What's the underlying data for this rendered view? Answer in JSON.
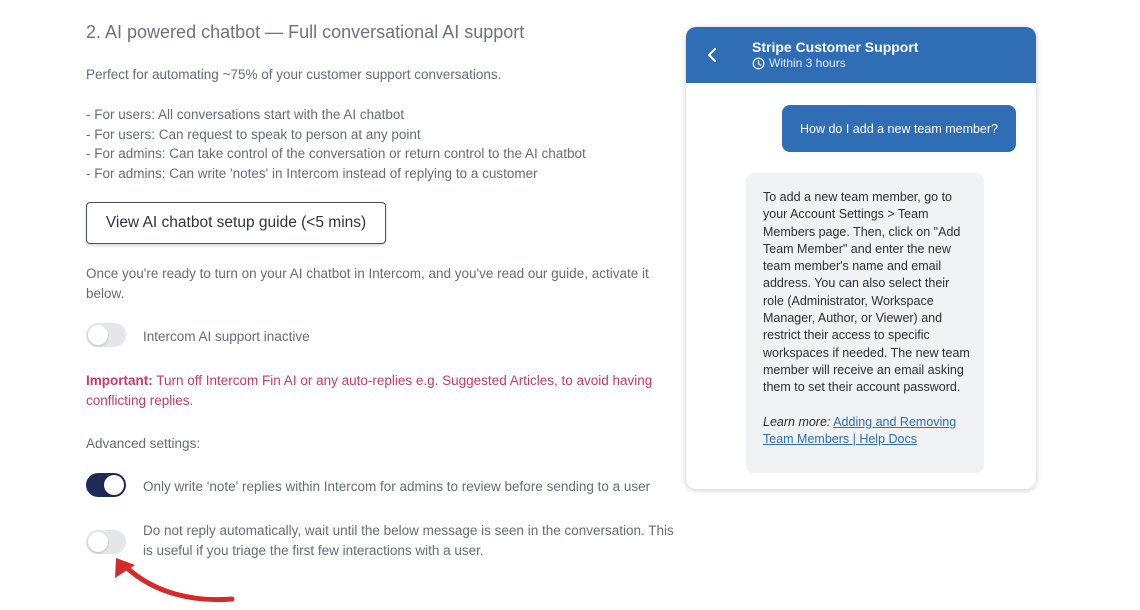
{
  "section": {
    "title": "2. AI powered chatbot — Full conversational AI support",
    "intro": "Perfect for automating ~75% of your customer support conversations.",
    "bullets": [
      "- For users: All conversations start with the AI chatbot",
      "- For users: Can request to speak to person at any point",
      "- For admins: Can take control of the conversation or return control to the AI chatbot",
      "- For admins: Can write 'notes' in Intercom instead of replying to a customer"
    ],
    "guide_button": "View AI chatbot setup guide (<5 mins)",
    "activate_text": "Once you're ready to turn on your AI chatbot in Intercom, and you've read our guide, activate it below.",
    "ai_toggle": {
      "label": "Intercom AI support inactive",
      "on": false
    },
    "important": {
      "prefix": "Important:",
      "text": " Turn off Intercom Fin AI or any auto-replies e.g. Suggested Articles, to avoid having conflicting replies."
    },
    "advanced_heading": "Advanced settings:",
    "note_toggle": {
      "label": "Only write 'note' replies within Intercom for admins to review before sending to a user",
      "on": true
    },
    "wait_toggle": {
      "label": "Do not reply automatically, wait until the below message is seen in the conversation. This is useful if you triage the first few interactions with a user.",
      "on": false
    }
  },
  "chat": {
    "title": "Stripe Customer Support",
    "subtitle": "Within 3 hours",
    "user_message": "How do I add a new team member?",
    "bot_message": "To add a new team member, go to your Account Settings > Team Members page. Then, click on \"Add Team Member\" and enter the new team member's name and email address. You can also select their role (Administrator, Workspace Manager, Author, or Viewer) and restrict their access to specific workspaces if needed. The new team member will receive an email asking them to set their account password.",
    "learn_more_label": "Learn more:",
    "learn_more_link": "Adding and Removing Team Members | Help Docs"
  },
  "colors": {
    "header_blue": "#2f6db5",
    "toggle_on": "#1e2b57",
    "important_red": "#c43a6a",
    "annotation_arrow": "#d42a2a"
  },
  "icons": [
    "chevron-left-icon",
    "clock-icon",
    "red-arrow-annotation"
  ]
}
